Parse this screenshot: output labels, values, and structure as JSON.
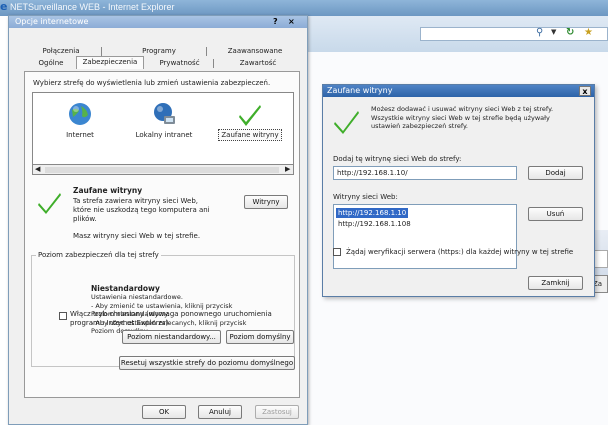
{
  "browser": {
    "title": "NETSurveillance WEB - Internet Explorer"
  },
  "background_page": {
    "button_fragment": "Za"
  },
  "dialog": {
    "title": "Opcje internetowe",
    "help": "?",
    "close": "×",
    "tabs_row1": [
      "Połączenia",
      "Programy",
      "Zaawansowane"
    ],
    "tabs_row2": [
      "Ogólne",
      "Zabezpieczenia",
      "Prywatność",
      "Zawartość"
    ],
    "active_tab": "Zabezpieczenia",
    "zone_prompt": "Wybierz strefę do wyświetlenia lub zmień ustawienia zabezpieczeń.",
    "zones": [
      {
        "label": "Internet",
        "icon": "globe-icon"
      },
      {
        "label": "Lokalny intranet",
        "icon": "intranet-icon"
      },
      {
        "label": "Zaufane witryny",
        "icon": "checkmark-icon",
        "selected": true
      }
    ],
    "zone_name": "Zaufane witryny",
    "zone_description": "Ta strefa zawiera witryny sieci Web, które nie uszkodzą tego komputera ani plików.",
    "sites_button": "Witryny",
    "zone_has_sites": "Masz witryny sieci Web w tej strefie.",
    "security_level_legend": "Poziom zabezpieczeń dla tej strefy",
    "level_title": "Niestandardowy",
    "level_desc": [
      "Ustawienia niestandardowe.",
      "- Aby zmienić te ustawienia, kliknij przycisk Poziom niestandardowy.",
      "- Aby użyć ustawień zalecanych, kliknij przycisk Poziom domyślny."
    ],
    "protected_mode_label": "Włącz tryb chroniony (wymaga ponownego uruchomienia programu Internet Explorer)",
    "protected_mode_checked": false,
    "custom_level_button": "Poziom niestandardowy...",
    "default_level_button": "Poziom domyślny",
    "reset_all_button": "Resetuj wszystkie strefy do poziomu domyślnego",
    "ok_button": "OK",
    "cancel_button": "Anuluj",
    "apply_button": "Zastosuj"
  },
  "sites_dialog": {
    "title": "Zaufane witryny",
    "close": "x",
    "info": "Możesz dodawać i usuwać witryny sieci Web z tej strefy. Wszystkie witryny sieci Web w tej strefie będą używały ustawień zabezpieczeń strefy.",
    "add_label": "Dodaj tę witrynę sieci Web do strefy:",
    "add_value": "http://192.168.1.10/",
    "add_button": "Dodaj",
    "list_label": "Witryny sieci Web:",
    "sites": [
      "http://192.168.1.10",
      "http://192.168.1.108"
    ],
    "selected_site_index": 0,
    "remove_button": "Usuń",
    "https_label": "Żądaj weryfikacji serwera (https:) dla każdej witryny w tej strefie",
    "https_checked": false,
    "close_button": "Zamknij"
  },
  "colors": {
    "check_green": "#3fae2a",
    "selection_blue": "#3169c6",
    "title_blue": "#2d63a8"
  }
}
